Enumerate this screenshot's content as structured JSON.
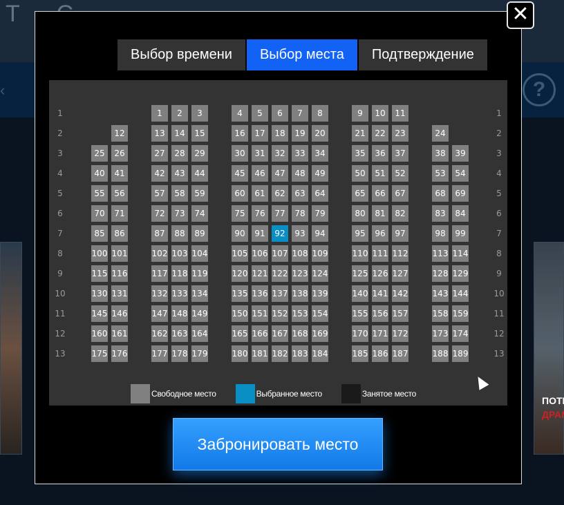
{
  "background": {
    "title_fragment": "T C",
    "help_glyph": "?",
    "chevron_glyph": "‹",
    "poster_right": {
      "line1": "ПОТЕ",
      "line2": "ДРАМ",
      "line1_color": "#ffffff",
      "line2_color": "#cc2222"
    }
  },
  "modal": {
    "close_glyph": "✕",
    "tabs": [
      {
        "label": "Выбор времени",
        "active": false
      },
      {
        "label": "Выбор места",
        "active": true
      },
      {
        "label": "Подтверждение",
        "active": false
      }
    ],
    "rows": [
      "1",
      "2",
      "3",
      "4",
      "5",
      "6",
      "7",
      "8",
      "9",
      "10",
      "11",
      "12",
      "13"
    ],
    "seat_colors": {
      "free": "#808080",
      "selected": "#0a8fc4",
      "occupied": "#1a1a1a"
    },
    "selected_seats": [
      92
    ],
    "legend": [
      {
        "label": "Свободное место",
        "color": "#808080"
      },
      {
        "label": "Выбранное место",
        "color": "#0a8fc4"
      },
      {
        "label": "Занятое место",
        "color": "#1a1a1a"
      }
    ],
    "book_button": "Забронировать место"
  }
}
